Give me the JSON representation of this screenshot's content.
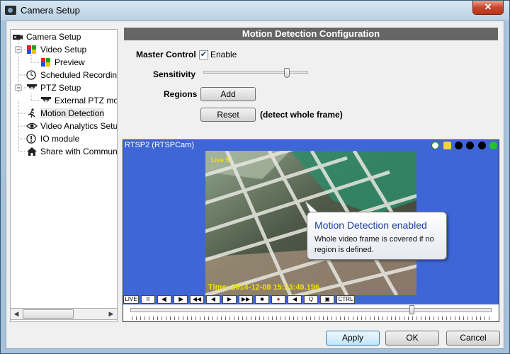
{
  "window": {
    "title": "Camera Setup",
    "close_glyph": "✕"
  },
  "tree": {
    "items": [
      {
        "label": "Camera Setup",
        "icon": "camera-icon"
      },
      {
        "label": "Video Setup",
        "icon": "color-grid-icon"
      },
      {
        "label": "Preview",
        "icon": "color-grid-icon"
      },
      {
        "label": "Scheduled Recording",
        "icon": "clock-icon"
      },
      {
        "label": "PTZ Setup",
        "icon": "dome-camera-icon"
      },
      {
        "label": "External PTZ moc",
        "icon": "dome-camera-icon"
      },
      {
        "label": "Motion Detection",
        "icon": "running-man-icon"
      },
      {
        "label": "Video Analytics Setup",
        "icon": "eye-icon"
      },
      {
        "label": "IO module",
        "icon": "exclamation-icon"
      },
      {
        "label": "Share with Communit",
        "icon": "home-icon"
      }
    ],
    "selected": "Motion Detection"
  },
  "config": {
    "header": "Motion Detection Configuration",
    "master_control_label": "Master Control",
    "enable_label": "Enable",
    "enable_checked": true,
    "sensitivity_label": "Sensitivity",
    "sensitivity_fraction": 0.8,
    "regions_label": "Regions",
    "add_button": "Add",
    "reset_button": "Reset",
    "reset_hint": "(detect whole frame)"
  },
  "camera": {
    "title": "RTSP2 (RTSPCam)",
    "live_tag": "Live 5",
    "timestamp": "Time: 2014-12-08 15:23:49.196",
    "callout_title": "Motion Detection enabled",
    "callout_body": "Whole video frame is covered if no region is defined.",
    "status_dots": [
      "#000000",
      "#000000",
      "#000000",
      "#22c32a"
    ],
    "toolbar": [
      "LIVE",
      "II",
      "◀|",
      "|▶",
      "◀◀",
      "◀",
      "▶",
      "▶▶",
      "■",
      "●",
      "◀",
      "Q",
      "▣",
      "CTRL"
    ],
    "seek_fraction": 0.78
  },
  "footer": {
    "apply": "Apply",
    "ok": "OK",
    "cancel": "Cancel"
  }
}
